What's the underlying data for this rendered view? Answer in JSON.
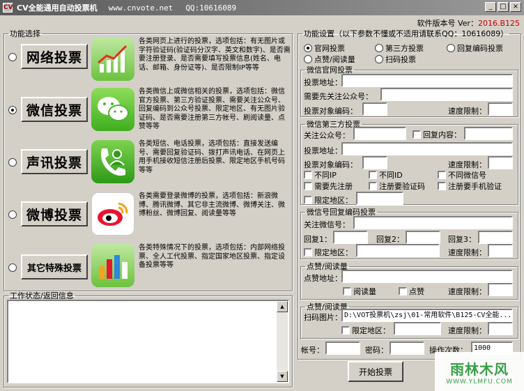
{
  "window": {
    "title": "CV全能通用自动投票机",
    "site": "www.cnvote.net",
    "qq": "QQ:10616089",
    "controls": [
      "_",
      "□",
      "×"
    ]
  },
  "version": {
    "label": "软件版本号 Ver：",
    "value": "2016.B125"
  },
  "func_select": {
    "legend": "功能选择",
    "items": [
      {
        "label": "网络投票",
        "icon": "chart-icon",
        "selected": false,
        "desc": "各类网页上进行的投票，选项包括：有无图片或字符验证码(验证码分汉字、英文和数字)、是否需要注册登录、是否需要填写投票信息(姓名、电话、邮箱、身份证等)、是否限制IP等等"
      },
      {
        "label": "微信投票",
        "icon": "wechat-icon",
        "selected": true,
        "desc": "各类微信上或微信相关的投票，选项包括：微信官方投票、第三方验证投票、需要关注公众号、回复编码到公众号投票、限定地区、有无图片验证码、是否需要注册第三方帐号、刷阅读量、点赞等等"
      },
      {
        "label": "声讯投票",
        "icon": "phone-contact-icon",
        "selected": false,
        "desc": "各类短信、电话投票，选项包括：直接发送编号、需要回复验证码、拨打声讯电话、在网页上用手机接收短信注册后投票、限定地区手机号码等等"
      },
      {
        "label": "微博投票",
        "icon": "weibo-icon",
        "selected": false,
        "desc": "各类需要登录微博的投票，选项包括：新浪微博、腾讯微博、其它非主流微博、微博关注、微博粉丝、微博回复、阅读量等等"
      },
      {
        "label": "其它特殊投票",
        "icon": "bar-chart-icon",
        "selected": false,
        "desc": "各类特殊情况下的投票，选项包括：内部网络投票、全人工代投票、指定国家地区投票、指定设备投票等等"
      }
    ]
  },
  "status": {
    "legend": "工作状态/返回信息",
    "text": ""
  },
  "settings": {
    "legend": "功能设置（以下参数不懂或不适用请联系QQ：10616089）",
    "modes": [
      {
        "label": "官网投票",
        "selected": true
      },
      {
        "label": "第三方投票",
        "selected": false
      },
      {
        "label": "回复编码投票",
        "selected": false
      },
      {
        "label": "点赞/阅读量",
        "selected": false
      },
      {
        "label": "扫码投票",
        "selected": false
      }
    ],
    "official": {
      "legend": "微信官网投票",
      "vote_url_label": "投票地址：",
      "vote_url": "",
      "follow_label": "需要先关注公众号：",
      "follow": "",
      "code_label": "投票对象编码：",
      "code": "",
      "speed_label": "速度限制：",
      "speed": ""
    },
    "third": {
      "legend": "微信第三方投票",
      "account_label": "关注公众号：",
      "account": "",
      "reply_label": "回复内容：",
      "reply": "",
      "url_label": "投票地址：",
      "url": "",
      "code_label": "投票对象编码：",
      "code": "",
      "speed_label": "速度限制：",
      "speed": "",
      "checks": [
        "不同IP",
        "不同ID",
        "不同微信号",
        "需要先注册",
        "注册要验证码",
        "注册要手机验证"
      ],
      "region_label": "限定地区：",
      "region": ""
    },
    "reply_code": {
      "legend": "微信号回复编码投票",
      "follow_label": "关注微信号：",
      "follow": "",
      "r1_label": "回复1：",
      "r1": "",
      "r2_label": "回复2：",
      "r2": "",
      "r3_label": "回复3：",
      "r3": "",
      "region_label": "限定地区：",
      "region": "",
      "speed_label": "速度限制：",
      "speed": ""
    },
    "like_read": {
      "legend": "点赞/阅读量",
      "url_label": "点赞地址：",
      "url": "",
      "read_label": "阅读量",
      "like_label": "点赞",
      "speed_label": "速度限制：",
      "speed": ""
    },
    "scan": {
      "legend": "点赞/阅读量",
      "image_label": "扫码图片：",
      "image": "D:\\VOT投票机\\zsj\\01-常用软件\\B125-CV全能...",
      "region_label": "限定地区：",
      "region": "",
      "speed_label": "速度限制：",
      "speed": ""
    },
    "account_label": "帐号：",
    "account": "",
    "password_label": "密码：",
    "password": "",
    "count_label": "操作次数：",
    "count": "1000"
  },
  "buttons": {
    "start": "开始投票"
  },
  "watermark": {
    "top": "雨林木风",
    "bottom": "WWW.YLMFU.COM"
  }
}
